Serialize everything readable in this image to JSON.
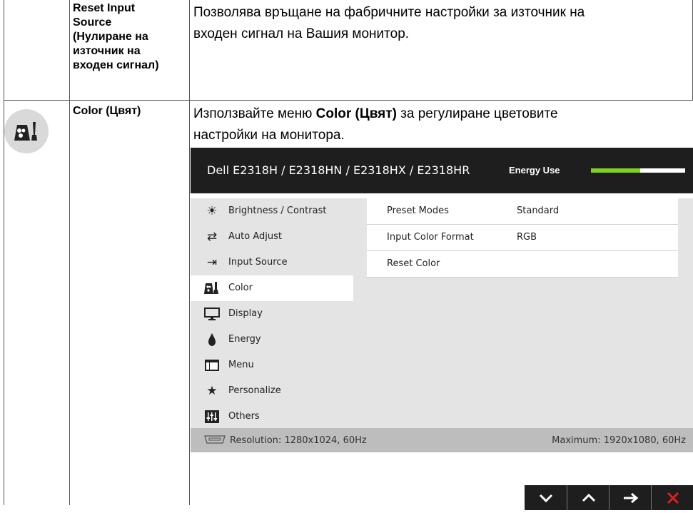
{
  "table": {
    "row1": {
      "label_lines": [
        "Reset Input",
        "Source",
        "(Нулиране на",
        "източник на",
        "входен сигнал)"
      ],
      "description_lines": [
        "Позволява връщане на фабричните настройки за източник на",
        "входен сигнал на Вашия монитор."
      ]
    },
    "row2": {
      "icon": "color-palette-icon",
      "label": "Color (Цвят)",
      "description_pre": "Използвайте меню ",
      "description_bold": "Color (Цвят)",
      "description_post": " за регулиране цветовите",
      "description_line2": "настройки на монитора."
    }
  },
  "osd": {
    "title": "Dell E2318H / E2318HN / E2318HX / E2318HR",
    "energy_label": "Energy Use",
    "energy_level": 0.52,
    "menu": [
      {
        "label": "Brightness / Contrast",
        "icon": "sun-icon"
      },
      {
        "label": "Auto Adjust",
        "icon": "auto-adjust-icon"
      },
      {
        "label": "Input Source",
        "icon": "input-source-icon"
      },
      {
        "label": "Color",
        "icon": "color-icon",
        "active": true
      },
      {
        "label": "Display",
        "icon": "monitor-icon"
      },
      {
        "label": "Energy",
        "icon": "energy-icon"
      },
      {
        "label": "Menu",
        "icon": "menu-icon"
      },
      {
        "label": "Personalize",
        "icon": "star-icon"
      },
      {
        "label": "Others",
        "icon": "others-icon"
      }
    ],
    "settings": [
      {
        "key": "Preset Modes",
        "value": "Standard"
      },
      {
        "key": "Input Color Format",
        "value": "RGB"
      },
      {
        "key": "Reset Color",
        "value": ""
      }
    ],
    "status_left": "Resolution: 1280x1024, 60Hz",
    "status_right": "Maximum: 1920x1080, 60Hz",
    "buttons": [
      {
        "icon": "chevron-down-icon",
        "glyph": "⌄"
      },
      {
        "icon": "chevron-up-icon",
        "glyph": "⌃"
      },
      {
        "icon": "arrow-right-icon",
        "glyph": "→"
      },
      {
        "icon": "close-icon",
        "glyph": "✕"
      }
    ]
  }
}
